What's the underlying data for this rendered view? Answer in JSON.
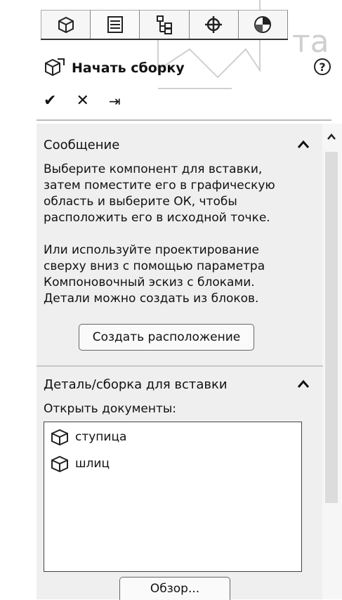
{
  "header": {
    "title": "Начать сборку",
    "watermark_fragment": "та"
  },
  "tabs": [
    {
      "icon": "feature-manager-icon"
    },
    {
      "icon": "property-manager-icon",
      "active": true
    },
    {
      "icon": "configuration-manager-icon"
    },
    {
      "icon": "dimxpert-manager-icon"
    },
    {
      "icon": "display-manager-icon"
    }
  ],
  "actions": {
    "ok": "✔",
    "cancel": "✕",
    "pin": "⇥"
  },
  "message": {
    "heading": "Сообщение",
    "paragraph1": "Выберите компонент для вставки,\nзатем поместите его в графическую\nобласть и выберите ОК, чтобы\nрасположить его в исходной точке.",
    "paragraph2": "Или используйте проектирование\nсверху вниз с помощью параметра\nКомпоновочный эскиз с блоками.\nДетали можно создать из блоков.",
    "button": "Создать расположение"
  },
  "insert": {
    "heading": "Деталь/сборка для вставки",
    "open_docs_label": "Открыть документы:",
    "documents": [
      "ступица",
      "шлиц"
    ],
    "browse_button": "Обзор..."
  }
}
